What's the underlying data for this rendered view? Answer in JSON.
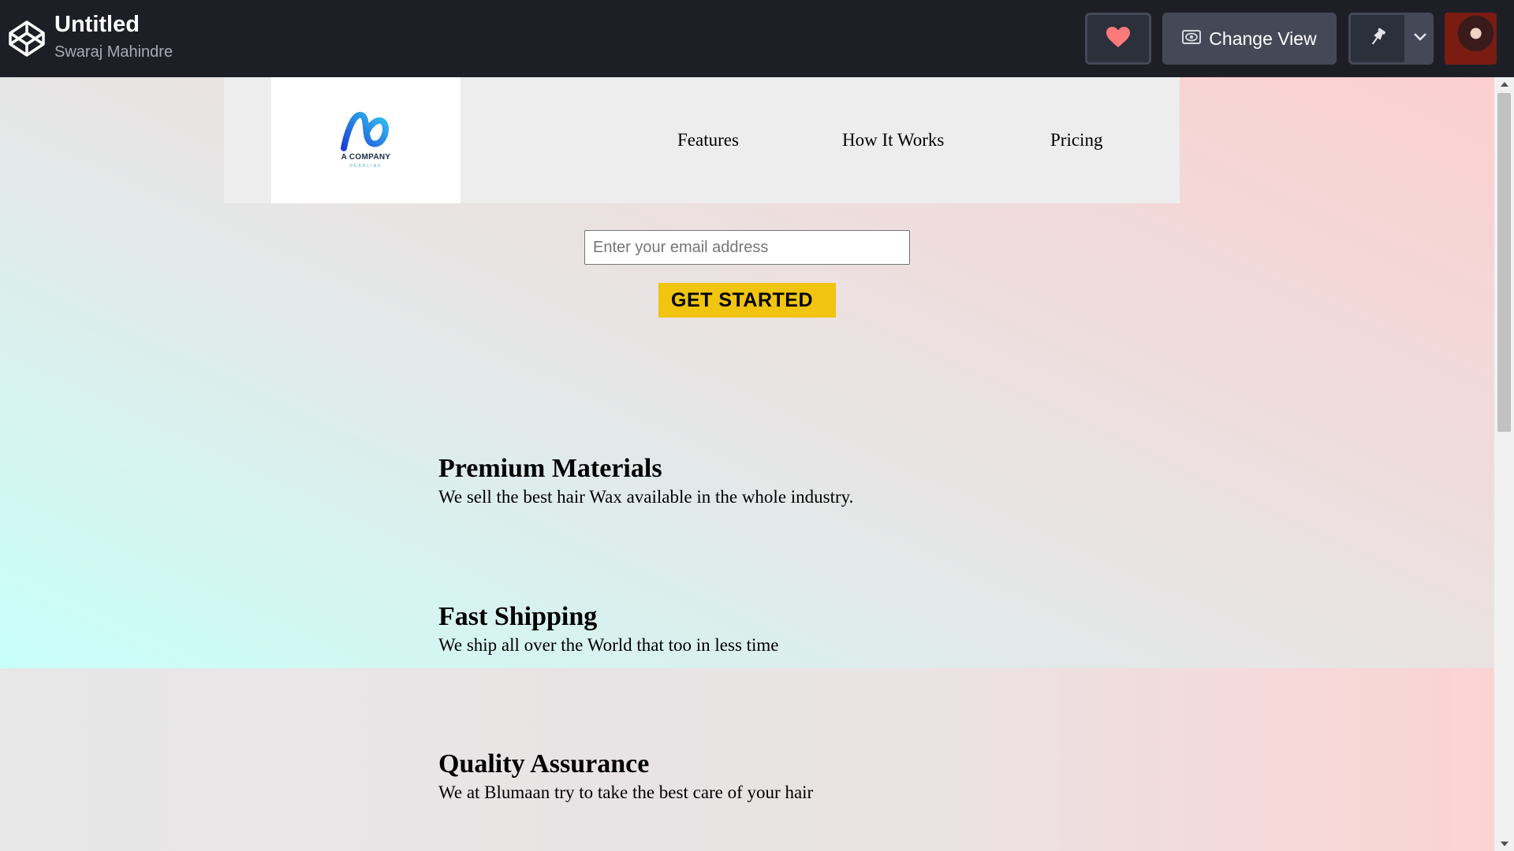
{
  "app": {
    "title": "Untitled",
    "author": "Swaraj Mahindre",
    "change_view_label": "Change View"
  },
  "site": {
    "logo": {
      "name": "A COMPANY",
      "tagline": "HEADLINE"
    },
    "nav": [
      "Features",
      "How It Works",
      "Pricing"
    ],
    "email_placeholder": "Enter your email address",
    "cta_label": "GET STARTED",
    "features": [
      {
        "title": "Premium Materials",
        "desc": "We sell the best hair Wax available in the whole industry."
      },
      {
        "title": "Fast Shipping",
        "desc": "We ship all over the World that too in less time"
      },
      {
        "title": "Quality Assurance",
        "desc": "We at Blumaan try to take the best care of your hair"
      }
    ]
  },
  "colors": {
    "appbar": "#1e1f26",
    "heart": "#ff7a7a",
    "cta": "#f1c40f",
    "gradient_start": "#c8fff9",
    "gradient_end": "#fccfcf"
  },
  "icons": [
    "codepen-logo-icon",
    "heart-icon",
    "eye-icon",
    "pin-icon",
    "chevron-down-icon"
  ]
}
